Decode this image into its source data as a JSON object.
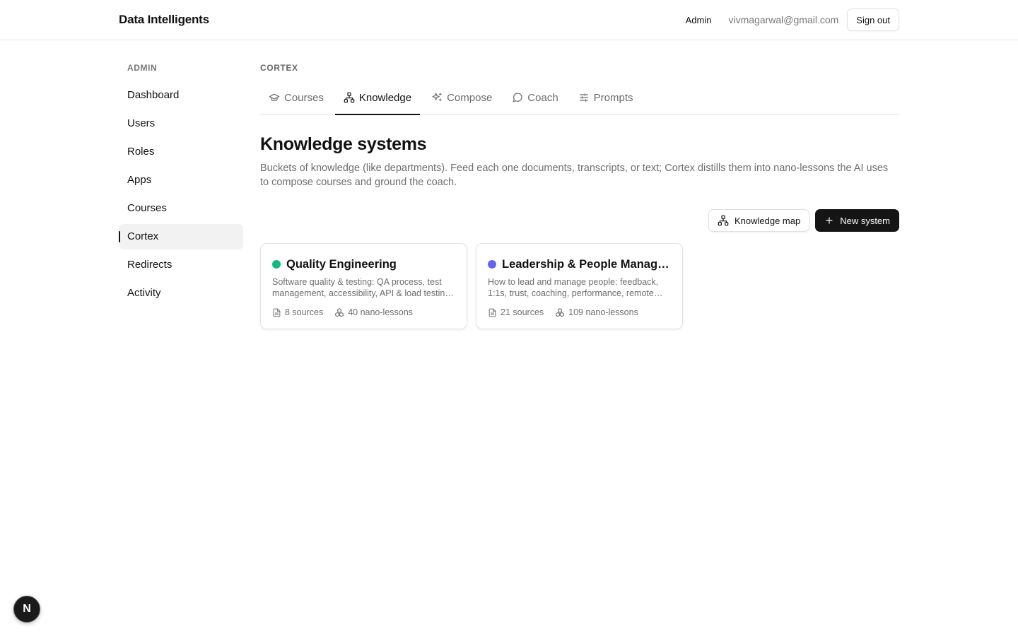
{
  "header": {
    "brand": "Data Intelligents",
    "admin_link": "Admin",
    "email": "vivmagarwal@gmail.com",
    "signout_label": "Sign out"
  },
  "sidebar": {
    "heading": "ADMIN",
    "items": [
      {
        "label": "Dashboard",
        "active": false
      },
      {
        "label": "Users",
        "active": false
      },
      {
        "label": "Roles",
        "active": false
      },
      {
        "label": "Apps",
        "active": false
      },
      {
        "label": "Courses",
        "active": false
      },
      {
        "label": "Cortex",
        "active": true
      },
      {
        "label": "Redirects",
        "active": false
      },
      {
        "label": "Activity",
        "active": false
      }
    ]
  },
  "main": {
    "section_label": "CORTEX",
    "tabs": [
      {
        "label": "Courses",
        "icon": "graduation-cap-icon",
        "active": false
      },
      {
        "label": "Knowledge",
        "icon": "network-icon",
        "active": true
      },
      {
        "label": "Compose",
        "icon": "sparkles-icon",
        "active": false
      },
      {
        "label": "Coach",
        "icon": "message-circle-icon",
        "active": false
      },
      {
        "label": "Prompts",
        "icon": "sliders-icon",
        "active": false
      }
    ],
    "title": "Knowledge systems",
    "description": "Buckets of knowledge (like departments). Feed each one documents, transcripts, or text; Cortex distills them into nano-lessons the AI uses to compose courses and ground the coach.",
    "actions": {
      "knowledge_map_label": "Knowledge map",
      "new_system_label": "New system"
    },
    "cards": [
      {
        "title": "Quality Engineering",
        "color": "#10b981",
        "description": "Software quality & testing: QA process, test management, accessibility, API & load testing, automation and more.",
        "sources": "8 sources",
        "lessons": "40 nano-lessons"
      },
      {
        "title": "Leadership & People Management",
        "color": "#6366f1",
        "description": "How to lead and manage people: feedback, 1:1s, trust, coaching, performance, remote teams and more.",
        "sources": "21 sources",
        "lessons": "109 nano-lessons"
      }
    ]
  },
  "dev_badge": {
    "letter": "N"
  },
  "colors": {
    "primary_button": "#151515",
    "muted_text": "#6e6e6e",
    "border": "#e3e3e3"
  }
}
